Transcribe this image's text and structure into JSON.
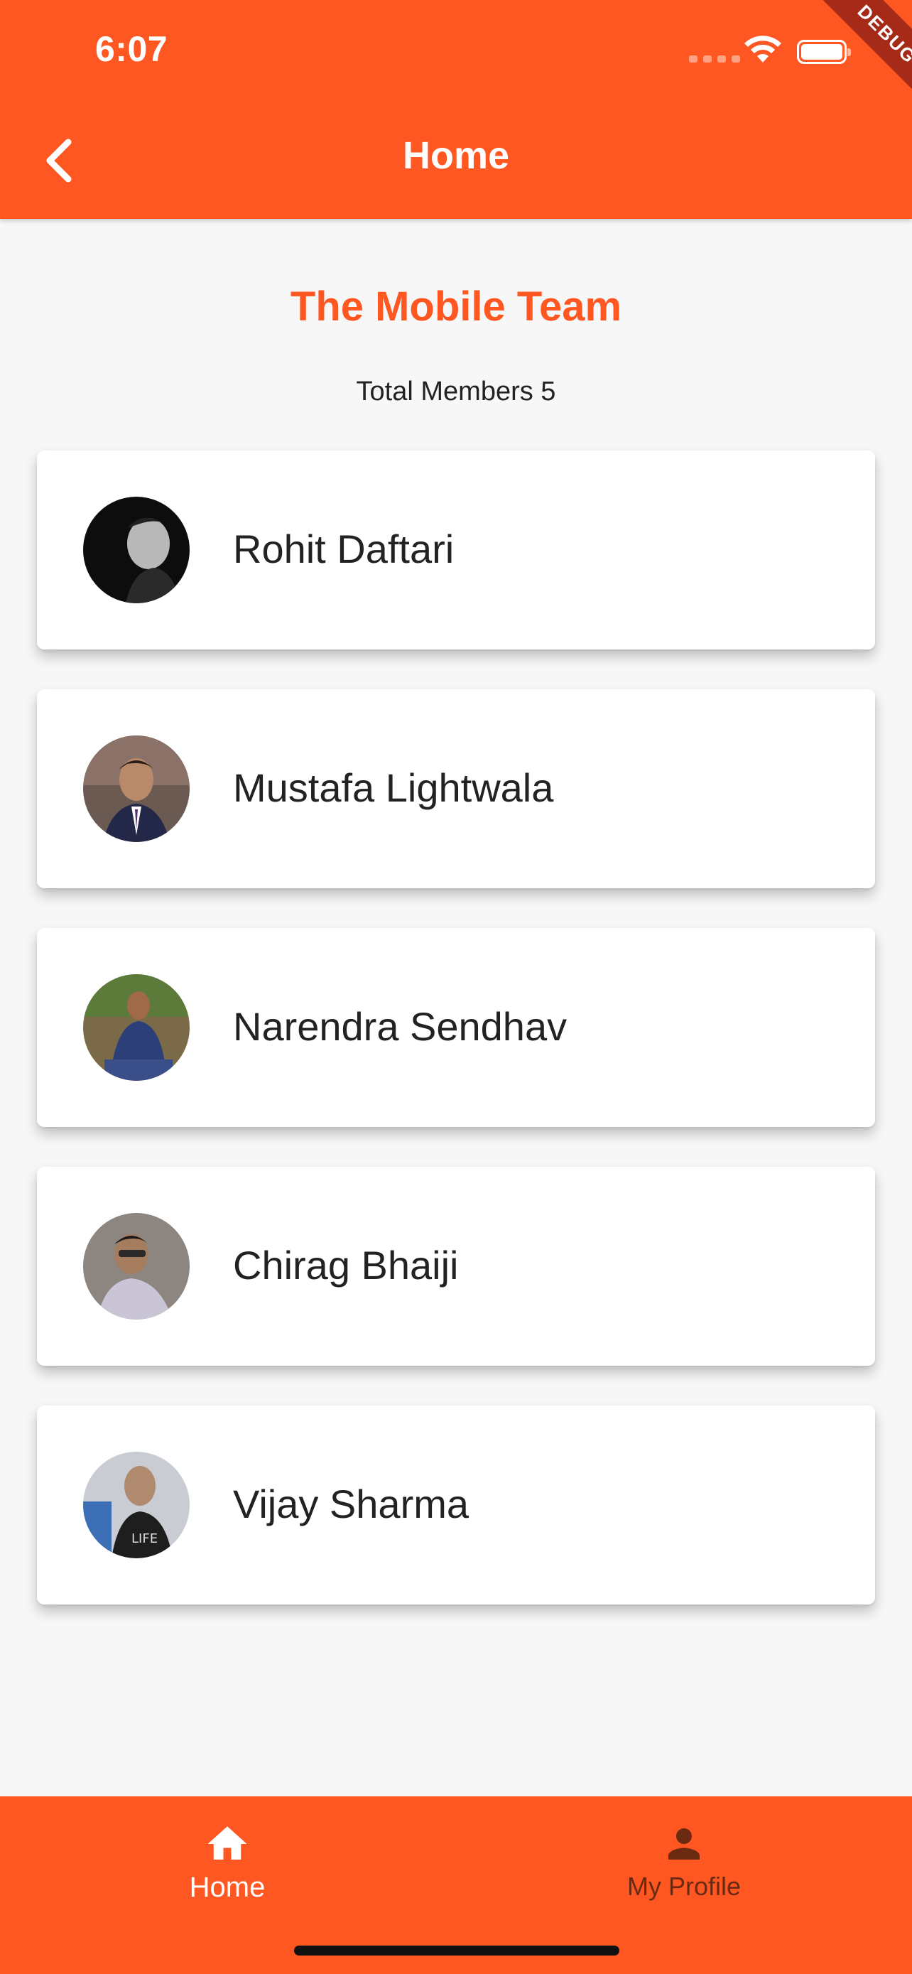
{
  "status_bar": {
    "time": "6:07",
    "icons": [
      "signal-icon",
      "wifi-icon",
      "battery-icon"
    ]
  },
  "debug_banner": "DEBUG",
  "app_bar": {
    "title": "Home",
    "back_icon": "chevron-left-icon"
  },
  "team": {
    "name": "The Mobile Team",
    "members_line": "Total Members 5"
  },
  "members": [
    {
      "name": "Rohit Daftari",
      "avatar": "avatar-photo"
    },
    {
      "name": "Mustafa Lightwala",
      "avatar": "avatar-photo"
    },
    {
      "name": "Narendra Sendhav",
      "avatar": "avatar-photo"
    },
    {
      "name": "Chirag Bhaiji",
      "avatar": "avatar-photo"
    },
    {
      "name": "Vijay Sharma",
      "avatar": "avatar-photo"
    }
  ],
  "bottom_nav": {
    "items": [
      {
        "label": "Home",
        "icon": "home-icon",
        "selected": true
      },
      {
        "label": "My Profile",
        "icon": "person-icon",
        "selected": false
      }
    ]
  },
  "colors": {
    "primary": "#ff5722",
    "background": "#f7f7f7",
    "card": "#ffffff",
    "text": "#222222",
    "nav_unselected": "#6a2a12"
  }
}
